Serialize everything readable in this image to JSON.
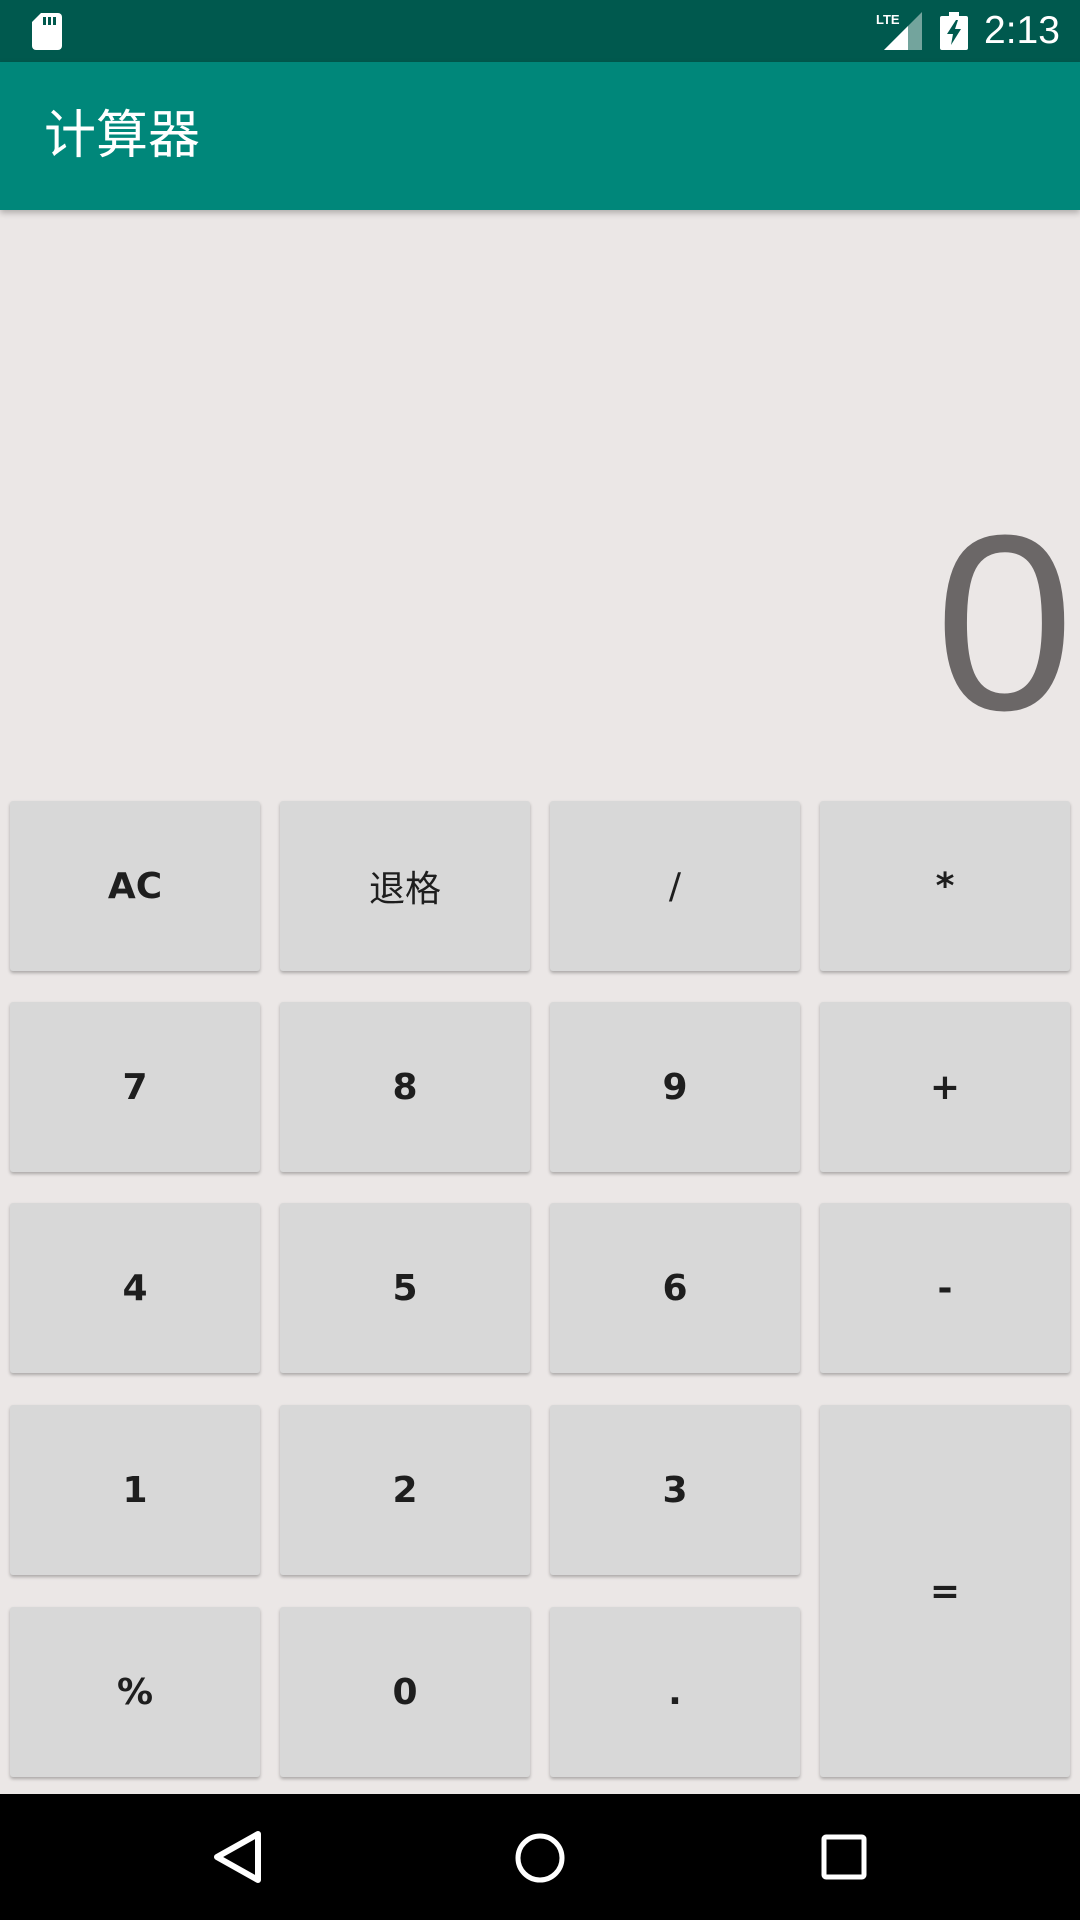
{
  "status_bar": {
    "time": "2:13",
    "icons": [
      "sd-card-icon",
      "lte-signal-icon",
      "battery-charging-icon"
    ]
  },
  "app_bar": {
    "title": "计算器",
    "color": "#00877a"
  },
  "display": {
    "value": "0"
  },
  "keypad": {
    "ac": "AC",
    "backspace": "退格",
    "divide": "/",
    "multiply": "*",
    "seven": "7",
    "eight": "8",
    "nine": "9",
    "plus": "+",
    "four": "4",
    "five": "5",
    "six": "6",
    "minus": "-",
    "one": "1",
    "two": "2",
    "three": "3",
    "equals": "=",
    "percent": "%",
    "zero": "0",
    "dot": "."
  },
  "nav_bar": {
    "icons": [
      "back-icon",
      "home-icon",
      "recents-icon"
    ]
  },
  "colors": {
    "status_bar": "#00594e",
    "app_bar": "#00877a",
    "background": "#ebe7e6",
    "key": "#d8d8d8",
    "display_text": "#6b6767"
  }
}
